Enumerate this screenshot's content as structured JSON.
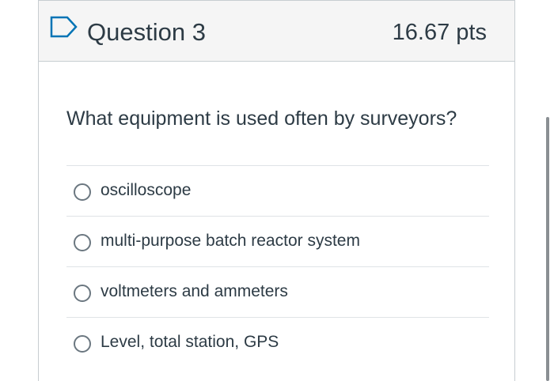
{
  "question": {
    "title": "Question 3",
    "points": "16.67 pts",
    "text": "What equipment is used often by surveyors?",
    "answers": [
      {
        "label": "oscilloscope",
        "selected": false
      },
      {
        "label": "multi-purpose batch reactor system",
        "selected": false
      },
      {
        "label": "voltmeters and ammeters",
        "selected": false
      },
      {
        "label": "Level, total station, GPS",
        "selected": false
      }
    ]
  },
  "icons": {
    "flag": "flag-question-icon"
  },
  "colors": {
    "text": "#2d3b45",
    "header_bg": "#f5f5f5",
    "border": "#c7cdd1",
    "accent": "#0374b5"
  }
}
